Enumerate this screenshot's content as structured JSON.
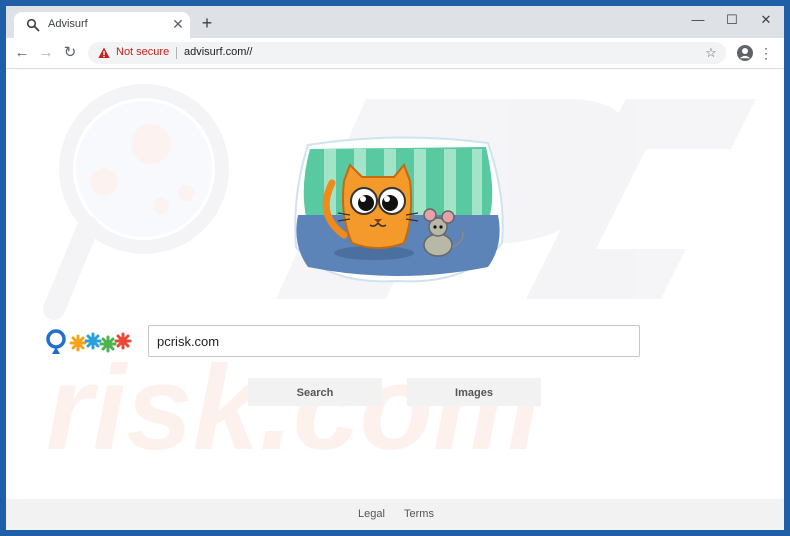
{
  "browser": {
    "tab": {
      "title": "Advisurf",
      "favicon_icon": "search-icon",
      "close_icon": "close-icon"
    },
    "new_tab_icon": "plus-icon",
    "window_controls": [
      "minimize-icon",
      "maximize-icon",
      "close-icon"
    ],
    "nav": [
      "back-icon",
      "forward-icon",
      "reload-icon"
    ],
    "omnibox": {
      "security_label": "Not secure",
      "url": "advisurf.com//",
      "bookmark_icon": "star-icon"
    },
    "profile_icon": "account-icon",
    "menu_icon": "more-vert-icon"
  },
  "page": {
    "search_value": "pcrisk.com",
    "buttons": {
      "search": "Search",
      "images": "Images"
    },
    "footer": {
      "legal": "Legal",
      "terms": "Terms"
    }
  },
  "watermark": {
    "text": "risk.com"
  },
  "colors": {
    "window_border": "#1f5fa8",
    "tabbar": "#dee1e6",
    "not_secure": "#c5221f",
    "button_bg": "#f2f2f2",
    "footer_bg": "#f2f2f2"
  }
}
